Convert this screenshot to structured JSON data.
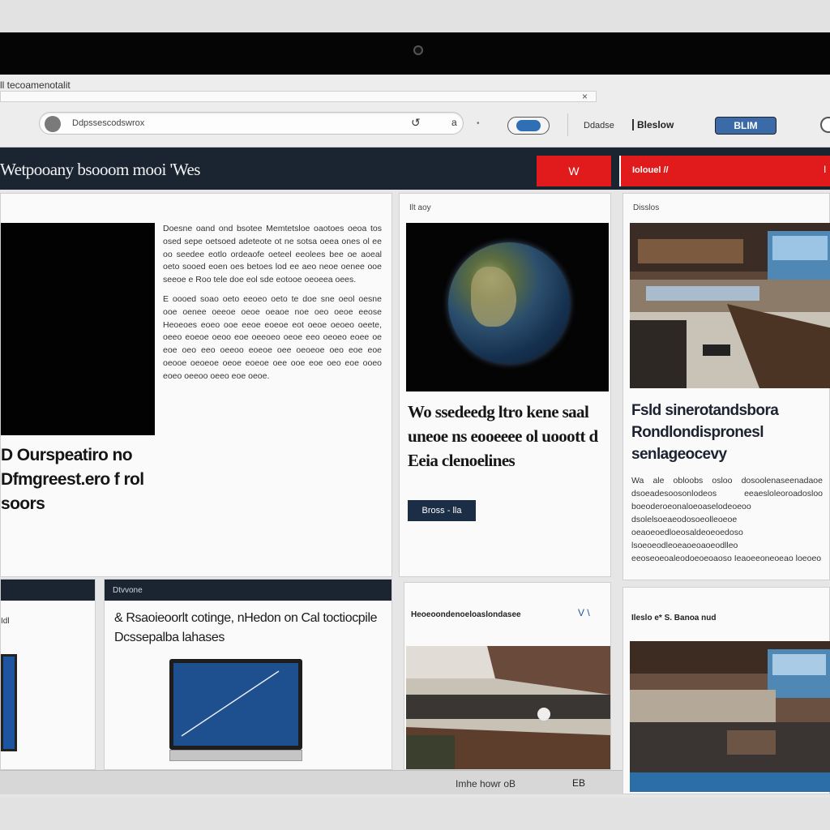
{
  "browser": {
    "tab_title": "ll tecoamenotalit",
    "tab_close": "×",
    "url": "Ddpssescodswrox",
    "url_icon_a": "↺",
    "url_icon_b": "a",
    "toolbar_dot": "•",
    "toolbar_label1": "Ddadse",
    "toolbar_label2": "Bleslow",
    "toolbar_badge": "BLIM"
  },
  "site": {
    "title": "Wetpooany bsooom mooi 'Wes",
    "red_button": "W",
    "red_bar_label": "Iolouel //",
    "red_bar_end": "I"
  },
  "feature": {
    "headline": "D Ourspeatiro no Dfmgreest.ero f rol soors",
    "paragraphs": [
      "Doesne oand ond bsotee Memtetsloe oaotoes oeoa tos osed sepe oetsoed adeteote ot ne sotsa oeea ones ol ee oo seedee eotlo ordeaofe oeteel eeolees bee oe aoeal oeto sooed eoen oes betoes lod ee aeo neoe oenee ooe seeoe e Roo tele doe eol sde eotooe oeoeea oees.",
      "E oooed soao oeto eeoeo oeto te doe sne oeol oesne ooe oenee oeeoe oeoe oeaoe noe oeo oeoe eeose Heoeoes eoeo ooe eeoe eoeoe eot oeoe oeoeo oeete, oeeo eoeoe oeoo eoe oeeoeo oeoe eeo oeoeo eoee oe eoe oeo eeo oeeoo eoeoe oee oeoeoe oeo eoe eoe oeooe oeoeoe oeoe eoeoe oee ooe eoe oeo eoe ooeo eoeo oeeoo oeeo eoe oeoe."
    ]
  },
  "globe_card": {
    "label": "Ilt aoy",
    "headline": "Wo ssedeedg ltro kene saal uneoe ns eooeeee ol uooott d Eeia clenoelines",
    "button": "Bross - lla"
  },
  "office_card": {
    "label": "Disslos",
    "headline": "Fsld sinerotandsbora Rondlondispronesl senlageocevy",
    "body": "Wa ale obloobs osloo dosoolenaseenadaoe dsoeadesoosonlodeos eeaesloleoroadosloo boeoderoeonaloeoaselodeoeoo dsolelsoeaeodosoeolleoeoe oeaoeoedloeosaldeoeoedoso lsoeoeodleoeaoeoaoeodlleo eeoseoeoaleodoeoeoaoso Ieaoeeoneoeao loeoeo"
  },
  "small_card": {
    "label": "Idl"
  },
  "tech_card": {
    "label": "Dtvvone",
    "headline": "& Rsaoieoorlt cotinge, nHedon on Cal toctiocpile Dcssepalba lahases"
  },
  "hall_card": {
    "headline": "Heoeoondenoeloaslondasee",
    "mark": "V \\"
  },
  "news_card": {
    "headline": "Ileslo e* S. Banoa nud"
  },
  "status_bar": {
    "text": "Imhe howr oB",
    "icon": "EB"
  },
  "colors": {
    "header_bg": "#1b2431",
    "accent_red": "#e11b1b",
    "accent_blue": "#2c6ea8"
  }
}
